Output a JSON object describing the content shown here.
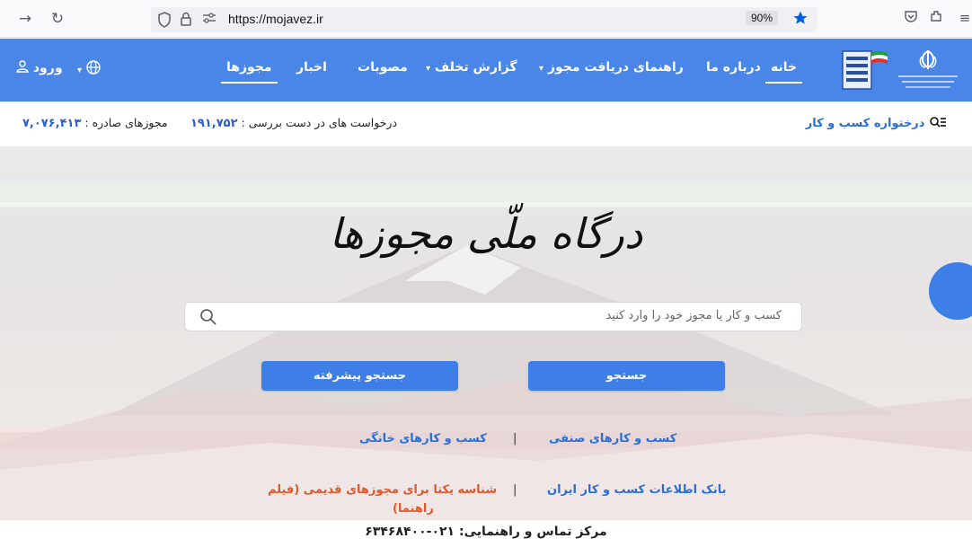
{
  "browser": {
    "url": "https://mojavez.ir",
    "zoom": "90%"
  },
  "header": {
    "nav": {
      "home": "خانه",
      "about": "درباره ما",
      "guide": "راهنمای دریافت مجوز",
      "violation_report": "گزارش تخلف",
      "approvals": "مصوبات",
      "news": "اخبار",
      "permits": "مجوزها"
    },
    "login_label": "ورود"
  },
  "stats": {
    "issued_label": "مجوزهای صادره :",
    "issued_value": "۷,۰۷۶,۴۱۳",
    "pending_label": "درخواست های در دست بررسی :",
    "pending_value": "۱۹۱,۷۵۲",
    "business_link": "درختواره کسب و کار"
  },
  "hero": {
    "title": "درگاه ملّی مجوزها",
    "search_placeholder": "کسب و کار یا مجوز خود را وارد کنید",
    "search_button": "جستجو",
    "advanced_search_button": "جستجو پیشرفته",
    "links": {
      "guild_business": "کسب و کارهای صنفی",
      "home_business": "کسب و کارهای خانگی",
      "business_info_bank": "بانک اطلاعات کسب و کار ایران",
      "unique_id_line1": "شناسه یکتا برای مجوزهای قدیمی (فیلم",
      "unique_id_line2": "راهنما)",
      "separator": "|"
    }
  },
  "contact": {
    "text": "مرکز تماس و راهنمایی: ۰۲۱-۶۳۴۶۸۴۰۰"
  },
  "colors": {
    "header_blue": "#4a86e8",
    "button_blue": "#3d7fe6",
    "link_blue": "#2a6fd6",
    "link_orange": "#e0572b"
  }
}
